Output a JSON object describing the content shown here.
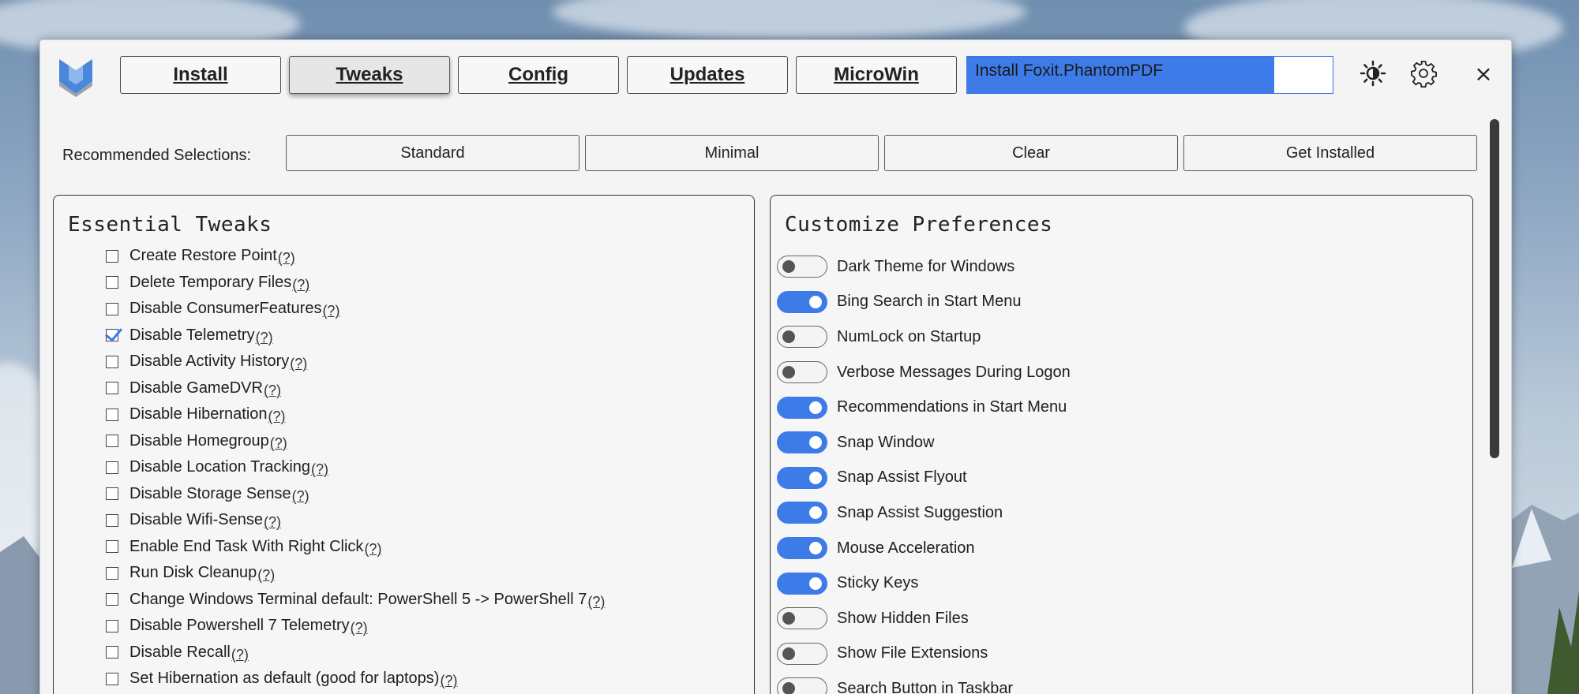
{
  "window": {
    "tabs": [
      {
        "label": "Install",
        "active": false
      },
      {
        "label": "Tweaks",
        "active": true
      },
      {
        "label": "Config",
        "active": false
      },
      {
        "label": "Updates",
        "active": false
      },
      {
        "label": "MicroWin",
        "active": false
      }
    ],
    "progress": {
      "label": "Install Foxit.PhantomPDF",
      "value": 0.84
    },
    "icons": [
      "sun-icon",
      "gear-icon",
      "close-icon"
    ],
    "close_glyph": "×"
  },
  "recommended": {
    "label": "Recommended Selections:",
    "buttons": [
      "Standard",
      "Minimal",
      "Clear",
      "Get Installed"
    ]
  },
  "essential": {
    "title": "Essential Tweaks",
    "help_label": "(?)",
    "items": [
      {
        "label": "Create Restore Point",
        "checked": false
      },
      {
        "label": "Delete Temporary Files",
        "checked": false
      },
      {
        "label": "Disable ConsumerFeatures",
        "checked": false
      },
      {
        "label": "Disable Telemetry",
        "checked": true
      },
      {
        "label": "Disable Activity History",
        "checked": false
      },
      {
        "label": "Disable GameDVR",
        "checked": false
      },
      {
        "label": "Disable Hibernation",
        "checked": false
      },
      {
        "label": "Disable Homegroup",
        "checked": false
      },
      {
        "label": "Disable Location Tracking",
        "checked": false
      },
      {
        "label": "Disable Storage Sense",
        "checked": false
      },
      {
        "label": "Disable Wifi-Sense",
        "checked": false
      },
      {
        "label": "Enable End Task With Right Click",
        "checked": false
      },
      {
        "label": "Run Disk Cleanup",
        "checked": false
      },
      {
        "label": "Change Windows Terminal default: PowerShell 5 -> PowerShell 7",
        "checked": false
      },
      {
        "label": "Disable Powershell 7 Telemetry",
        "checked": false
      },
      {
        "label": "Disable Recall",
        "checked": false
      },
      {
        "label": "Set Hibernation as default (good for laptops)",
        "checked": false
      }
    ]
  },
  "preferences": {
    "title": "Customize Preferences",
    "items": [
      {
        "label": "Dark Theme for Windows",
        "on": false
      },
      {
        "label": "Bing Search in Start Menu",
        "on": true
      },
      {
        "label": "NumLock on Startup",
        "on": false
      },
      {
        "label": "Verbose Messages During Logon",
        "on": false
      },
      {
        "label": "Recommendations in Start Menu",
        "on": true
      },
      {
        "label": "Snap Window",
        "on": true
      },
      {
        "label": "Snap Assist Flyout",
        "on": true
      },
      {
        "label": "Snap Assist Suggestion",
        "on": true
      },
      {
        "label": "Mouse Acceleration",
        "on": true
      },
      {
        "label": "Sticky Keys",
        "on": true
      },
      {
        "label": "Show Hidden Files",
        "on": false
      },
      {
        "label": "Show File Extensions",
        "on": false
      },
      {
        "label": "Search Button in Taskbar",
        "on": false
      }
    ]
  }
}
